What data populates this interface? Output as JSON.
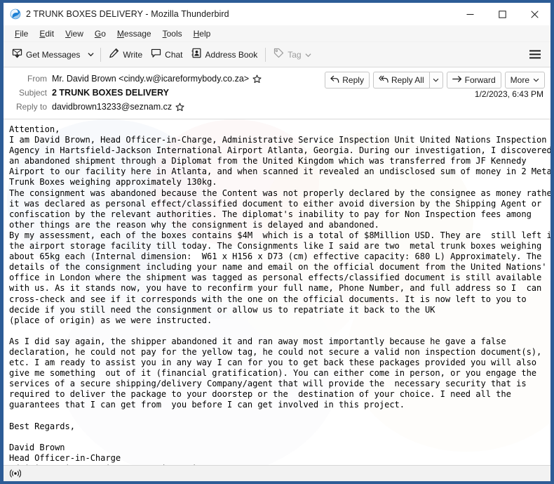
{
  "window": {
    "title": "2 TRUNK BOXES DELIVERY - Mozilla Thunderbird",
    "app_icon": "thunderbird-icon",
    "minimize_label": "─",
    "maximize_label": "□",
    "close_label": "✕",
    "frame_color": "#2d5c96"
  },
  "menubar": {
    "items": [
      {
        "label": "File",
        "mnemonic": "F",
        "rest": "ile"
      },
      {
        "label": "Edit",
        "mnemonic": "E",
        "rest": "dit"
      },
      {
        "label": "View",
        "mnemonic": "V",
        "rest": "iew"
      },
      {
        "label": "Go",
        "mnemonic": "G",
        "rest": "o"
      },
      {
        "label": "Message",
        "mnemonic": "M",
        "rest": "essage"
      },
      {
        "label": "Tools",
        "mnemonic": "T",
        "rest": "ools"
      },
      {
        "label": "Help",
        "mnemonic": "H",
        "rest": "elp"
      }
    ]
  },
  "toolbar": {
    "get_messages_label": "Get Messages",
    "write_label": "Write",
    "chat_label": "Chat",
    "address_book_label": "Address Book",
    "tag_label": "Tag",
    "menu_button": "hamburger-icon"
  },
  "message": {
    "from_label": "From",
    "from_value": "Mr. David Brown <cindy.w@icareformybody.co.za>",
    "subject_label": "Subject",
    "subject_value": "2 TRUNK BOXES DELIVERY",
    "reply_to_label": "Reply to",
    "reply_to_value": "davidbrown13233@seznam.cz",
    "date": "1/2/2023, 6:43 PM",
    "actions": {
      "reply": "Reply",
      "reply_all": "Reply All",
      "forward": "Forward",
      "more": "More"
    },
    "body": "Attention,\nI am David Brown, Head Officer-in-Charge, Administrative Service Inspection Unit United Nations Inspection\nAgency in Hartsfield-Jackson International Airport Atlanta, Georgia. During our investigation, I discovered\nan abandoned shipment through a Diplomat from the United Kingdom which was transferred from JF Kennedy\nAirport to our facility here in Atlanta, and when scanned it revealed an undisclosed sum of money in 2 Metal\nTrunk Boxes weighing approximately 130kg.\nThe consignment was abandoned because the Content was not properly declared by the consignee as money rather\nit was declared as personal effect/classified document to either avoid diversion by the Shipping Agent or\nconfiscation by the relevant authorities. The diplomat's inability to pay for Non Inspection fees among\nother things are the reason why the consignment is delayed and abandoned.\nBy my assessment, each of the boxes contains $4M  which is a total of $8Million USD. They are  still left in\nthe airport storage facility till today. The Consignments like I said are two  metal trunk boxes weighing\nabout 65kg each (Internal dimension:  W61 x H156 x D73 (cm) effective capacity: 680 L) Approximately. The\ndetails of the consignment including your name and email on the official document from the United Nations'\noffice in London where the shipment was tagged as personal effects/classified document is still available\nwith us. As it stands now, you have to reconfirm your full name, Phone Number, and full address so I  can\ncross-check and see if it corresponds with the one on the official documents. It is now left to you to\ndecide if you still need the consignment or allow us to repatriate it back to the UK\n(place of origin) as we were instructed.\n\nAs I did say again, the shipper abandoned it and ran away most importantly because he gave a false\ndeclaration, he could not pay for the yellow tag, he could not secure a valid non inspection document(s),\netc. I am ready to assist you in any way I can for you to get back these packages provided you will also\ngive me something  out of it (financial gratification). You can either come in person, or you engage the\nservices of a secure shipping/delivery Company/agent that will provide the  necessary security that is\nrequired to deliver the package to your doorstep or the  destination of your choice. I need all the\nguarantees that I can get from  you before I can get involved in this project.\n\nBest Regards,\n\nDavid Brown\nHead Officer-in-Charge\nAdministrative Service Inspection Unit."
  },
  "statusbar": {
    "icon": "connection-broadcast-icon",
    "text": ""
  }
}
